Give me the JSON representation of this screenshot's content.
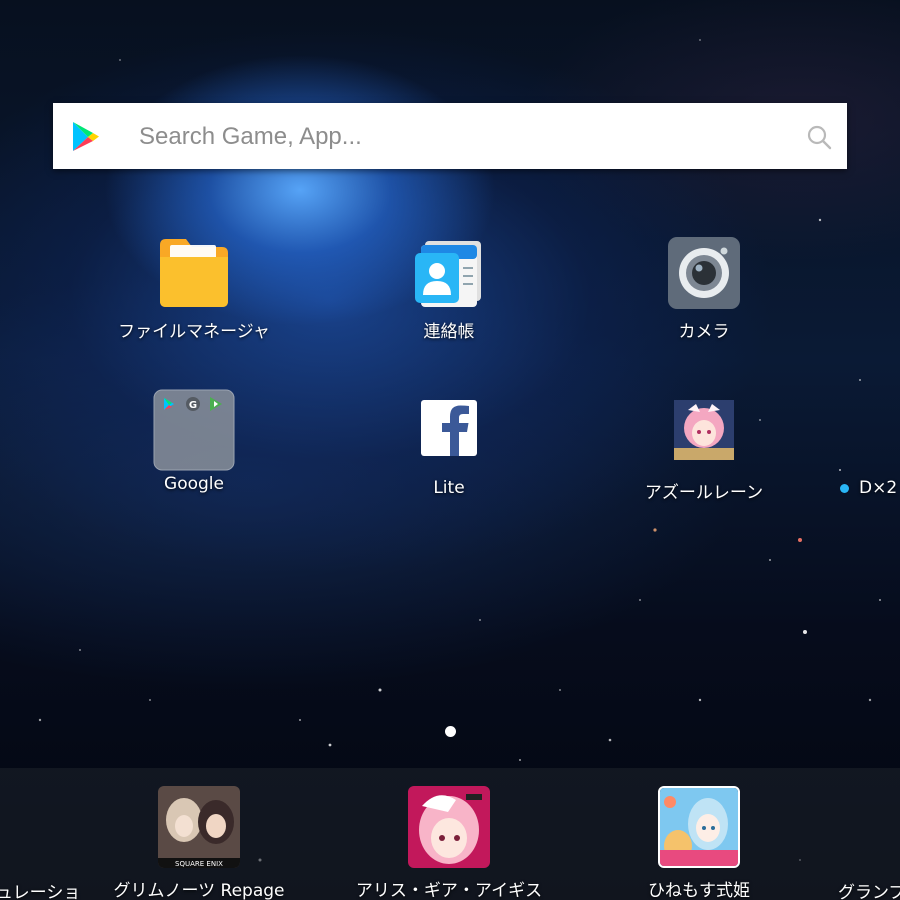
{
  "search": {
    "placeholder": "Search Game, App..."
  },
  "desktop": {
    "icons": [
      {
        "label": "ファイルマネージャ",
        "icon": "file-manager-folder-icon"
      },
      {
        "label": "連絡帳",
        "icon": "contacts-card-icon"
      },
      {
        "label": "カメラ",
        "icon": "camera-lens-icon"
      },
      {
        "label": "Google",
        "icon": "google-folder-icon"
      },
      {
        "label": "Lite",
        "icon": "facebook-lite-icon"
      },
      {
        "label": "アズールレーン",
        "icon": "azur-lane-app-icon"
      }
    ],
    "partial_item": {
      "label": "D×2",
      "badge_color": "#29b6f6"
    }
  },
  "dock": {
    "left_partial_label": "ュレーショ",
    "items": [
      {
        "label": "グリムノーツ Repage",
        "badge": "SQUARE ENIX"
      },
      {
        "label": "アリス・ギア・アイギス"
      },
      {
        "label": "ひねもす式姫"
      }
    ],
    "right_partial_label": "グランブ"
  },
  "colors": {
    "folder_yellow": "#fbc02d",
    "search_bg": "#ffffff",
    "placeholder": "#8d8d8d",
    "facebook_blue": "#3b5998"
  }
}
